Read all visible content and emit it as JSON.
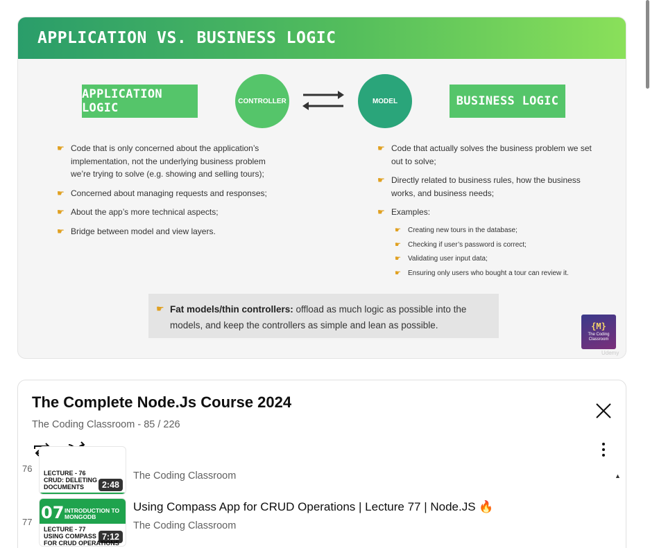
{
  "slide": {
    "title": "APPLICATION VS. BUSINESS LOGIC",
    "app_logic_label": "APPLICATION LOGIC",
    "controller_label": "CONTROLLER",
    "model_label": "MODEL",
    "business_logic_label": "BUSINESS LOGIC",
    "left_bullets": [
      "Code that is only concerned about the application’s implementation, not the underlying business problem we’re trying to solve (e.g. showing and selling tours);",
      "Concerned about managing requests and responses;",
      "About the app’s more technical aspects;",
      "Bridge between model and view layers."
    ],
    "right_bullets": [
      "Code that actually solves the business problem we set out to solve;",
      "Directly related to business rules, how the business works, and business needs;",
      "Examples:"
    ],
    "examples": [
      "Creating new tours in the database;",
      "Checking if user’s password is correct;",
      "Validating user input data;",
      "Ensuring only users who bought a tour can review it."
    ],
    "note_bold": "Fat models/thin controllers:",
    "note_text": " offload as much logic as possible into the models, and keep the controllers as simple and lean as possible.",
    "logo_mark": "{M}",
    "logo_name_1": "The Coding",
    "logo_name_2": "Classroom",
    "watermark": "Udemy",
    "colors": {
      "header_start": "#2a9d6a",
      "header_end": "#8ae05a",
      "controller": "#55c56a",
      "model": "#2aa57a"
    }
  },
  "playlist": {
    "title": "The Complete Node.Js Course 2024",
    "channel": "The Coding Classroom",
    "position": "85 / 226",
    "close_icon": "close-icon",
    "loop_icon": "loop-icon",
    "shuffle_icon": "shuffle-icon",
    "more_icon": "more-vert-icon",
    "items": [
      {
        "index": "76",
        "thumb_text_1": "LECTURE - 76",
        "thumb_text_2": "CRUD: DELETING",
        "thumb_text_3": "DOCUMENTS",
        "duration": "2:48",
        "channel": "The Coding Classroom"
      },
      {
        "index": "77",
        "thumb_big": "07",
        "thumb_big_lbl_1": "INTRODUCTION TO",
        "thumb_big_lbl_2": "MONGODB",
        "thumb_text_1": "LECTURE - 77",
        "thumb_text_2": "USING COMPASS",
        "thumb_text_3": "FOR CRUD OPERATIONS",
        "duration": "7:12",
        "title": "Using Compass App for CRUD Operations | Lecture 77 | Node.JS 🔥",
        "channel": "The Coding Classroom"
      }
    ]
  }
}
